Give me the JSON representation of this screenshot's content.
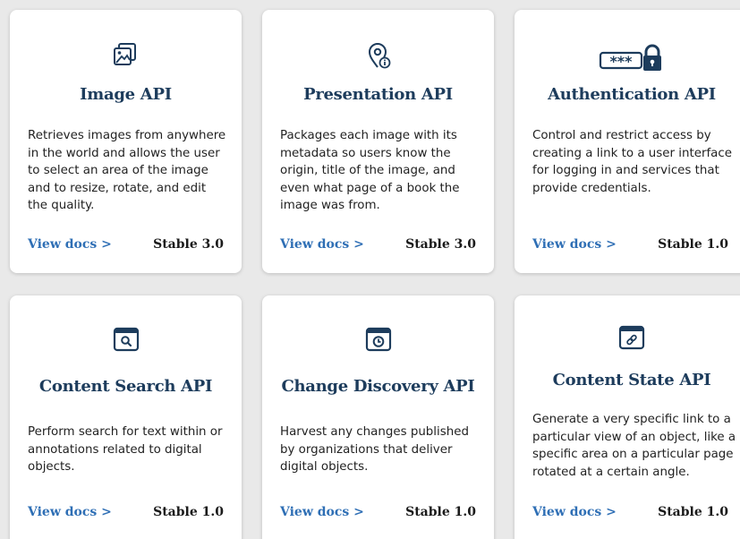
{
  "cards": [
    {
      "title": "Image API",
      "icon": "image-stack-icon",
      "description": "Retrieves images from anywhere in the world and allows the user to select an area of the image and to resize, rotate, and edit the quality.",
      "link_label": "View docs >",
      "version": "Stable 3.0"
    },
    {
      "title": "Presentation API",
      "icon": "map-pin-info-icon",
      "description": "Packages each image with its metadata so users know the origin, title of the image, and even what page of a book the image was from.",
      "link_label": "View docs >",
      "version": "Stable 3.0"
    },
    {
      "title": "Authentication API",
      "icon": "password-lock-icon",
      "description": "Control and restrict access by creating a link to a user interface for logging in and services that provide credentials.",
      "link_label": "View docs >",
      "version": "Stable 1.0"
    },
    {
      "title": "Content Search API",
      "icon": "browser-search-icon",
      "description": "Perform search for text within or annotations related to digital objects.",
      "link_label": "View docs >",
      "version": "Stable 1.0"
    },
    {
      "title": "Change Discovery API",
      "icon": "browser-clock-icon",
      "description": "Harvest any changes published by organizations that deliver digital objects.",
      "link_label": "View docs >",
      "version": "Stable 1.0"
    },
    {
      "title": "Content State API",
      "icon": "browser-link-icon",
      "description": "Generate a very specific link to a particular view of an object, like a specific area on a particular page rotated at a certain angle.",
      "link_label": "View docs >",
      "version": "Stable 1.0"
    }
  ],
  "colors": {
    "title": "#1d3c5c",
    "link": "#2f6fb5",
    "icon": "#1d3c5c",
    "background": "#e9e9e9"
  }
}
